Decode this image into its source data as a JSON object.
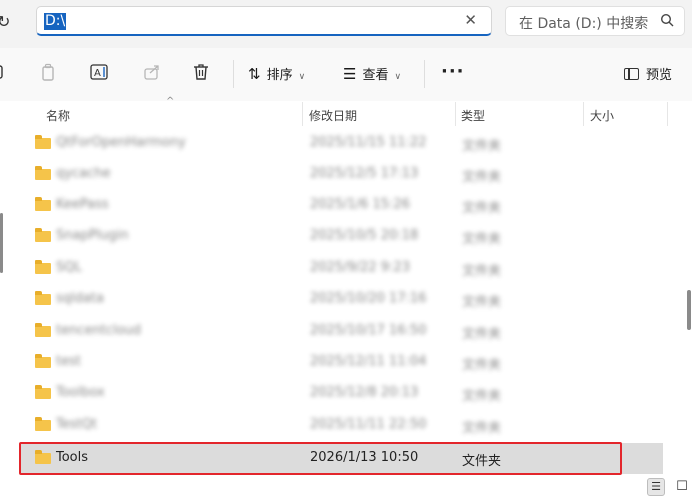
{
  "address_bar": {
    "path": "D:\\",
    "clear_icon": "✕",
    "refresh_icon": "refresh-icon"
  },
  "search": {
    "placeholder": "在 Data (D:) 中搜索",
    "icon": "search-icon"
  },
  "toolbar": {
    "sort_label": "排序",
    "view_label": "查看",
    "more_label": "···",
    "preview_label": "预览"
  },
  "columns": {
    "name": "名称",
    "modified": "修改日期",
    "type": "类型",
    "size": "大小"
  },
  "rows": [
    {
      "name": "QtForOpenHarmony",
      "modified": "2025/11/15 11:22",
      "type": "文件夹"
    },
    {
      "name": "qycache",
      "modified": "2025/12/5 17:13",
      "type": "文件夹"
    },
    {
      "name": "KeePass",
      "modified": "2025/1/6 15:26",
      "type": "文件夹"
    },
    {
      "name": "SnapPlugin",
      "modified": "2025/10/5 20:18",
      "type": "文件夹"
    },
    {
      "name": "SQL",
      "modified": "2025/9/22 9:23",
      "type": "文件夹"
    },
    {
      "name": "sqldata",
      "modified": "2025/10/20 17:16",
      "type": "文件夹"
    },
    {
      "name": "tencentcloud",
      "modified": "2025/10/17 16:50",
      "type": "文件夹"
    },
    {
      "name": "test",
      "modified": "2025/12/11 11:04",
      "type": "文件夹"
    },
    {
      "name": "Toolbox",
      "modified": "2025/12/8 20:13",
      "type": "文件夹"
    },
    {
      "name": "TestQt",
      "modified": "2025/11/11 22:50",
      "type": "文件夹"
    },
    {
      "name": "Tools",
      "modified": "2026/1/13 10:50",
      "type": "文件夹"
    }
  ],
  "selected_row": "Tools",
  "colors": {
    "accent": "#1664c0",
    "highlight_border": "#e3262c",
    "folder": "#f5c44a",
    "selected_bg": "#dcdcdc"
  }
}
